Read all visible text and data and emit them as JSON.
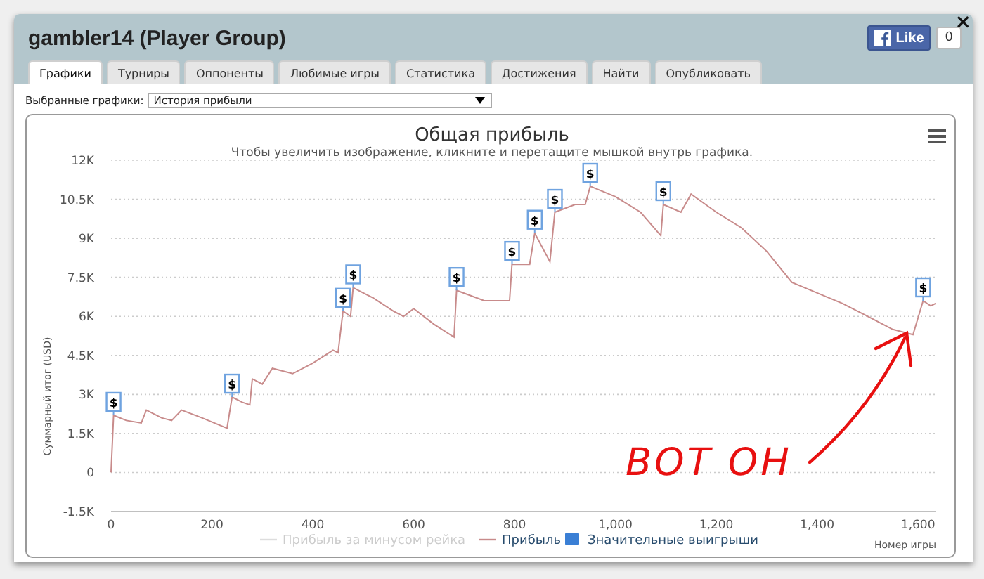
{
  "window": {
    "title": "gambler14 (Player Group)",
    "close": "×"
  },
  "like": {
    "label": "Like",
    "count": "0"
  },
  "tabs": [
    {
      "label": "Графики",
      "selected": true
    },
    {
      "label": "Турниры",
      "selected": false
    },
    {
      "label": "Оппоненты",
      "selected": false
    },
    {
      "label": "Любимые игры",
      "selected": false
    },
    {
      "label": "Статистика",
      "selected": false
    },
    {
      "label": "Достижения",
      "selected": false
    },
    {
      "label": "Найти",
      "selected": false
    },
    {
      "label": "Опубликовать",
      "selected": false
    }
  ],
  "graph_select": {
    "label": "Выбранные графики:",
    "value": "История прибыли"
  },
  "chart": {
    "subtitle": "Чтобы увеличить изображение, кликните и перетащите мышкой внутрь графика.",
    "legend": [
      {
        "label": "Прибыль за минусом рейка",
        "kind": "line",
        "disabled": true
      },
      {
        "kind": "series",
        "disabled": false
      },
      {
        "label": "Значительные выигрыши",
        "kind": "flag",
        "disabled": false,
        "color": "#3a7fd5"
      }
    ],
    "chart_data": {
      "type": "line",
      "title": "Общая прибыль",
      "xlabel": "Номер игры",
      "ylabel": "Суммарный итог (USD)",
      "grid": true,
      "x": [
        0,
        5,
        30,
        60,
        70,
        100,
        120,
        140,
        180,
        230,
        240,
        260,
        275,
        280,
        300,
        320,
        360,
        400,
        440,
        450,
        460,
        475,
        480,
        520,
        560,
        580,
        600,
        640,
        680,
        685,
        740,
        790,
        795,
        830,
        840,
        870,
        880,
        920,
        940,
        950,
        1000,
        1050,
        1090,
        1095,
        1130,
        1150,
        1200,
        1250,
        1300,
        1350,
        1400,
        1450,
        1500,
        1550,
        1590,
        1610,
        1625,
        1635
      ],
      "series": [
        {
          "name": "Прибыль",
          "color": "#c88b8b",
          "values": [
            0,
            2200,
            2000,
            1900,
            2400,
            2100,
            2000,
            2400,
            2100,
            1700,
            2900,
            2700,
            2600,
            3600,
            3400,
            4000,
            3800,
            4200,
            4700,
            4600,
            6200,
            6000,
            7100,
            6700,
            6200,
            6000,
            6300,
            5700,
            5200,
            7000,
            6600,
            6600,
            8000,
            8000,
            9200,
            8100,
            10000,
            10300,
            10300,
            11000,
            10600,
            10000,
            9100,
            10300,
            10000,
            10700,
            10000,
            9400,
            8500,
            7300,
            6900,
            6500,
            6000,
            5500,
            5300,
            6600,
            6400,
            6500
          ]
        }
      ],
      "xlim": [
        0,
        1636
      ],
      "ylim": [
        -1500,
        12000
      ],
      "xticks": [
        0,
        200,
        400,
        600,
        800,
        {
          "value": 1000,
          "label": "1,000"
        },
        {
          "value": 1200,
          "label": "1,200"
        },
        {
          "value": 1400,
          "label": "1,400"
        },
        {
          "value": 1600,
          "label": "1,600"
        }
      ],
      "yticks": [
        {
          "value": -1500,
          "label": "-1.5K"
        },
        0,
        {
          "value": 1500,
          "label": "1.5K"
        },
        {
          "value": 3000,
          "label": "3K"
        },
        {
          "value": 4500,
          "label": "4.5K"
        },
        {
          "value": 6000,
          "label": "6K"
        },
        {
          "value": 7500,
          "label": "7.5K"
        },
        {
          "value": 9000,
          "label": "9K"
        },
        {
          "value": 10500,
          "label": "10.5K"
        },
        {
          "value": 12000,
          "label": "12K"
        }
      ],
      "annotations": [
        {
          "x": 5,
          "y": 2200,
          "text": "$"
        },
        {
          "x": 240,
          "y": 2900,
          "text": "$"
        },
        {
          "x": 460,
          "y": 6200,
          "text": "$"
        },
        {
          "x": 480,
          "y": 7100,
          "text": "$"
        },
        {
          "x": 685,
          "y": 7000,
          "text": "$"
        },
        {
          "x": 795,
          "y": 8000,
          "text": "$"
        },
        {
          "x": 840,
          "y": 9200,
          "text": "$"
        },
        {
          "x": 880,
          "y": 10000,
          "text": "$"
        },
        {
          "x": 950,
          "y": 11000,
          "text": "$"
        },
        {
          "x": 1095,
          "y": 10300,
          "text": "$"
        },
        {
          "x": 1610,
          "y": 6600,
          "text": "$"
        }
      ]
    },
    "handwritten_note": "ВОТ ОН"
  }
}
